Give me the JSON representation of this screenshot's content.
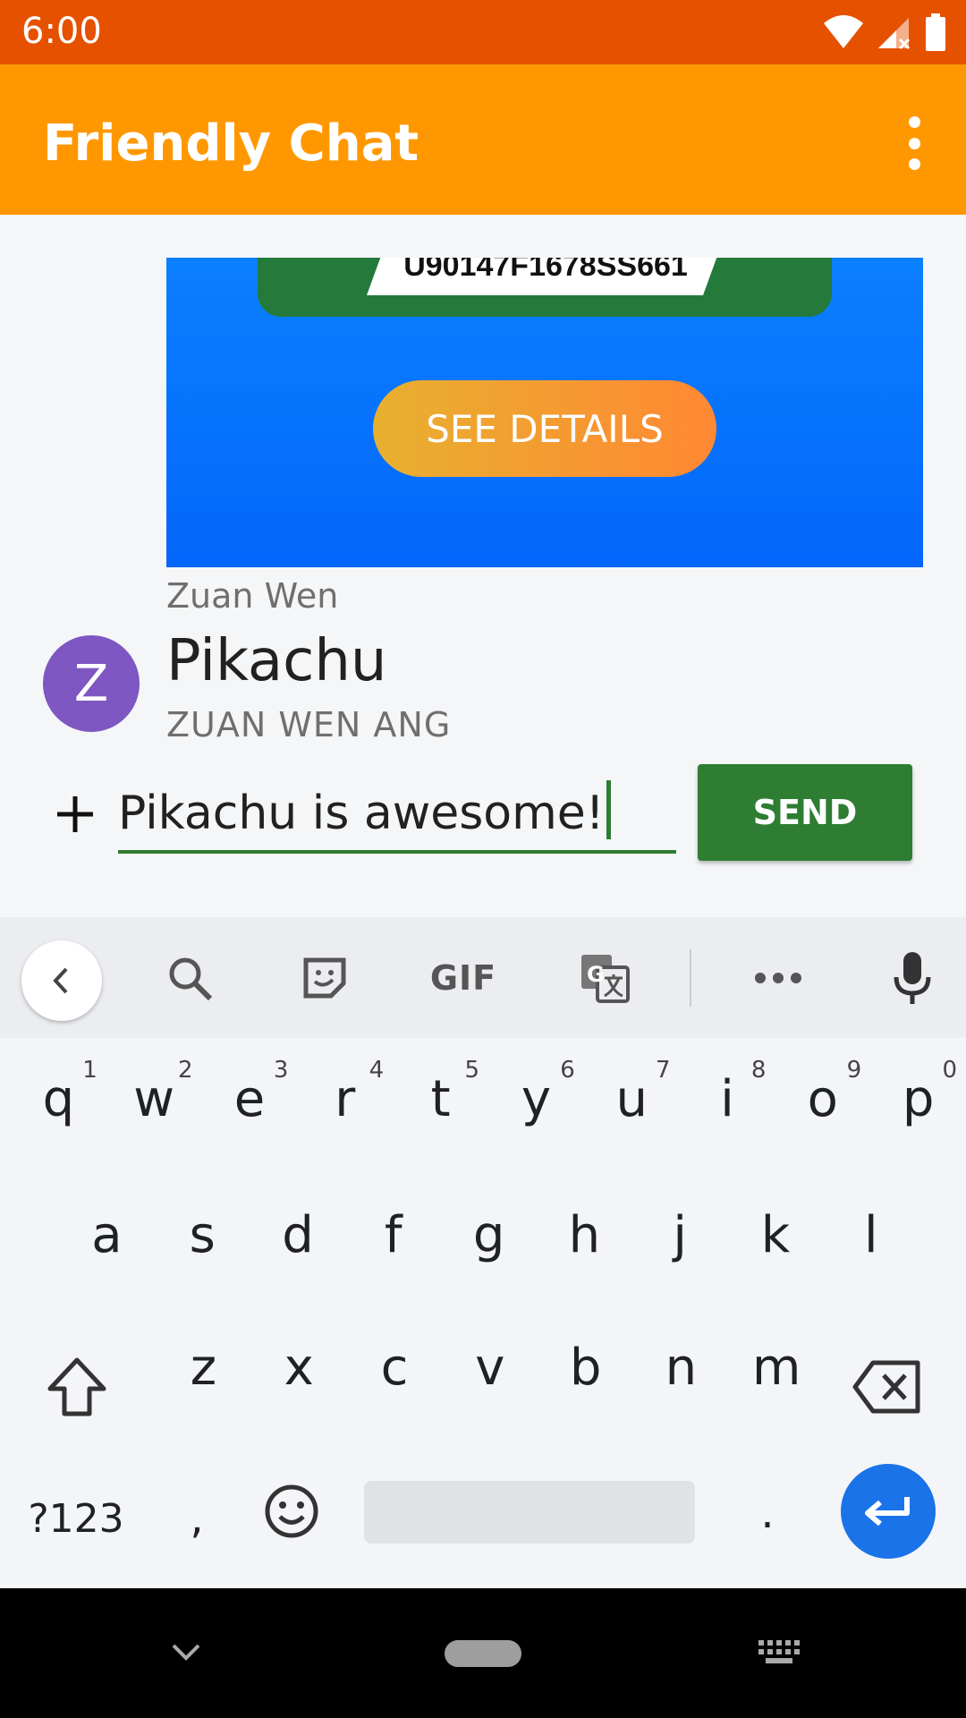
{
  "status_bar": {
    "time": "6:00"
  },
  "app_bar": {
    "title": "Friendly Chat"
  },
  "messages": [
    {
      "kind": "image",
      "code": "U90147F1678SS661",
      "button_label": "SEE DETAILS",
      "sender": "Zuan Wen"
    },
    {
      "kind": "text",
      "avatar_letter": "Z",
      "text": "Pikachu",
      "sender": "ZUAN WEN ANG"
    }
  ],
  "composer": {
    "input_value": "Pikachu is awesome!",
    "send_label": "SEND"
  },
  "keyboard": {
    "toolbar": {
      "gif_label": "GIF"
    },
    "rows": [
      [
        {
          "c": "q",
          "h": "1"
        },
        {
          "c": "w",
          "h": "2"
        },
        {
          "c": "e",
          "h": "3"
        },
        {
          "c": "r",
          "h": "4"
        },
        {
          "c": "t",
          "h": "5"
        },
        {
          "c": "y",
          "h": "6"
        },
        {
          "c": "u",
          "h": "7"
        },
        {
          "c": "i",
          "h": "8"
        },
        {
          "c": "o",
          "h": "9"
        },
        {
          "c": "p",
          "h": "0"
        }
      ],
      [
        {
          "c": "a"
        },
        {
          "c": "s"
        },
        {
          "c": "d"
        },
        {
          "c": "f"
        },
        {
          "c": "g"
        },
        {
          "c": "h"
        },
        {
          "c": "j"
        },
        {
          "c": "k"
        },
        {
          "c": "l"
        }
      ],
      [
        {
          "c": "z"
        },
        {
          "c": "x"
        },
        {
          "c": "c"
        },
        {
          "c": "v"
        },
        {
          "c": "b"
        },
        {
          "c": "n"
        },
        {
          "c": "m"
        }
      ]
    ],
    "symbols_label": "?123",
    "comma": ",",
    "period": "."
  },
  "colors": {
    "status_bar": "#e65100",
    "app_bar": "#ff9800",
    "send_button": "#2e7d32",
    "avatar": "#7e57c2",
    "enter_key": "#1a73e8"
  }
}
